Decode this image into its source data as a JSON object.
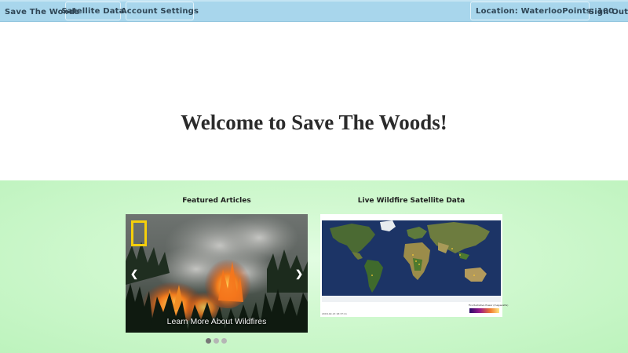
{
  "nav": {
    "brand": "Save The Woods",
    "satellite_label": "Satellite Data",
    "account_label": "Account Settings",
    "location_label": "Location: Waterloo",
    "points_label": "Points: 100",
    "signout_label": "Sign Out"
  },
  "welcome": {
    "title": "Welcome to Save The Woods!"
  },
  "featured": {
    "heading": "Featured Articles",
    "caption": "Learn More About Wildfires",
    "prev_symbol": "❮",
    "next_symbol": "❯",
    "slide_count": 3,
    "active_slide": 1
  },
  "satellite": {
    "heading": "Live Wildfire Satellite Data",
    "scale_label": "Fire Radiative Power (megawatts)",
    "date_label": "2018-02-13 18:37:11"
  },
  "colors": {
    "navbar": "#a8d6ec",
    "panel_green": "#c9f6c8",
    "logo_yellow": "#f6cf0a"
  },
  "icons": {
    "prev": "chevron-left-icon",
    "next": "chevron-right-icon",
    "logo": "national-geographic-logo"
  }
}
